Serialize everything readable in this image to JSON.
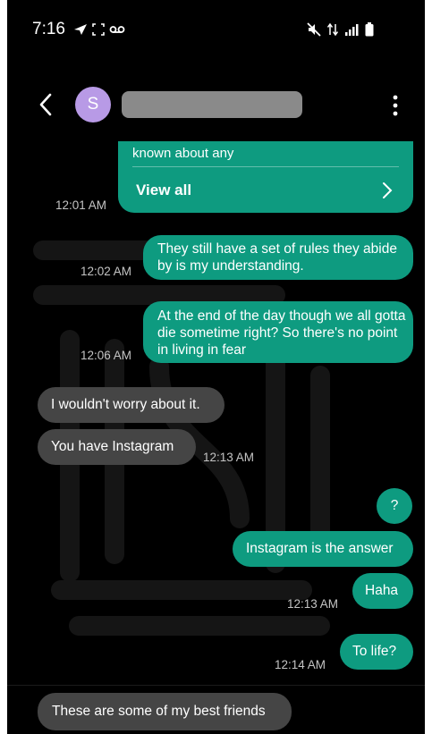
{
  "status_bar": {
    "time": "7:16",
    "left_icons": [
      "navigation-icon",
      "screenshot-frame-icon",
      "voicemail-icon"
    ],
    "right_icons": [
      "mute-icon",
      "data-arrows-icon",
      "signal-icon",
      "battery-icon"
    ]
  },
  "header": {
    "avatar_initial": "S",
    "contact_name": ""
  },
  "link_card": {
    "preview_text": "known about any",
    "view_all_label": "View all",
    "timestamp": "12:01 AM"
  },
  "messages": [
    {
      "direction": "sent",
      "text": "They still have a set of rules they abide by is my understanding.",
      "timestamp": "12:02 AM"
    },
    {
      "direction": "sent",
      "text": "At the end of the day though we all gotta die sometime right?  So there's no point in living in fear",
      "timestamp": "12:06 AM"
    },
    {
      "direction": "received",
      "text": "I wouldn't worry about it.",
      "timestamp": ""
    },
    {
      "direction": "received",
      "text": "You have Instagram",
      "timestamp": "12:13 AM"
    },
    {
      "direction": "sent",
      "text": "?",
      "timestamp": ""
    },
    {
      "direction": "sent",
      "text": "Instagram is the answer",
      "timestamp": ""
    },
    {
      "direction": "sent",
      "text": "Haha",
      "timestamp": "12:13 AM"
    },
    {
      "direction": "sent",
      "text": "To life?",
      "timestamp": "12:14 AM"
    },
    {
      "direction": "received",
      "text": "These are some of my best friends",
      "timestamp": ""
    }
  ],
  "colors": {
    "sent_bubble": "#0e9b80",
    "received_bubble": "#454545",
    "avatar": "#b89ae6",
    "background": "#000000"
  }
}
